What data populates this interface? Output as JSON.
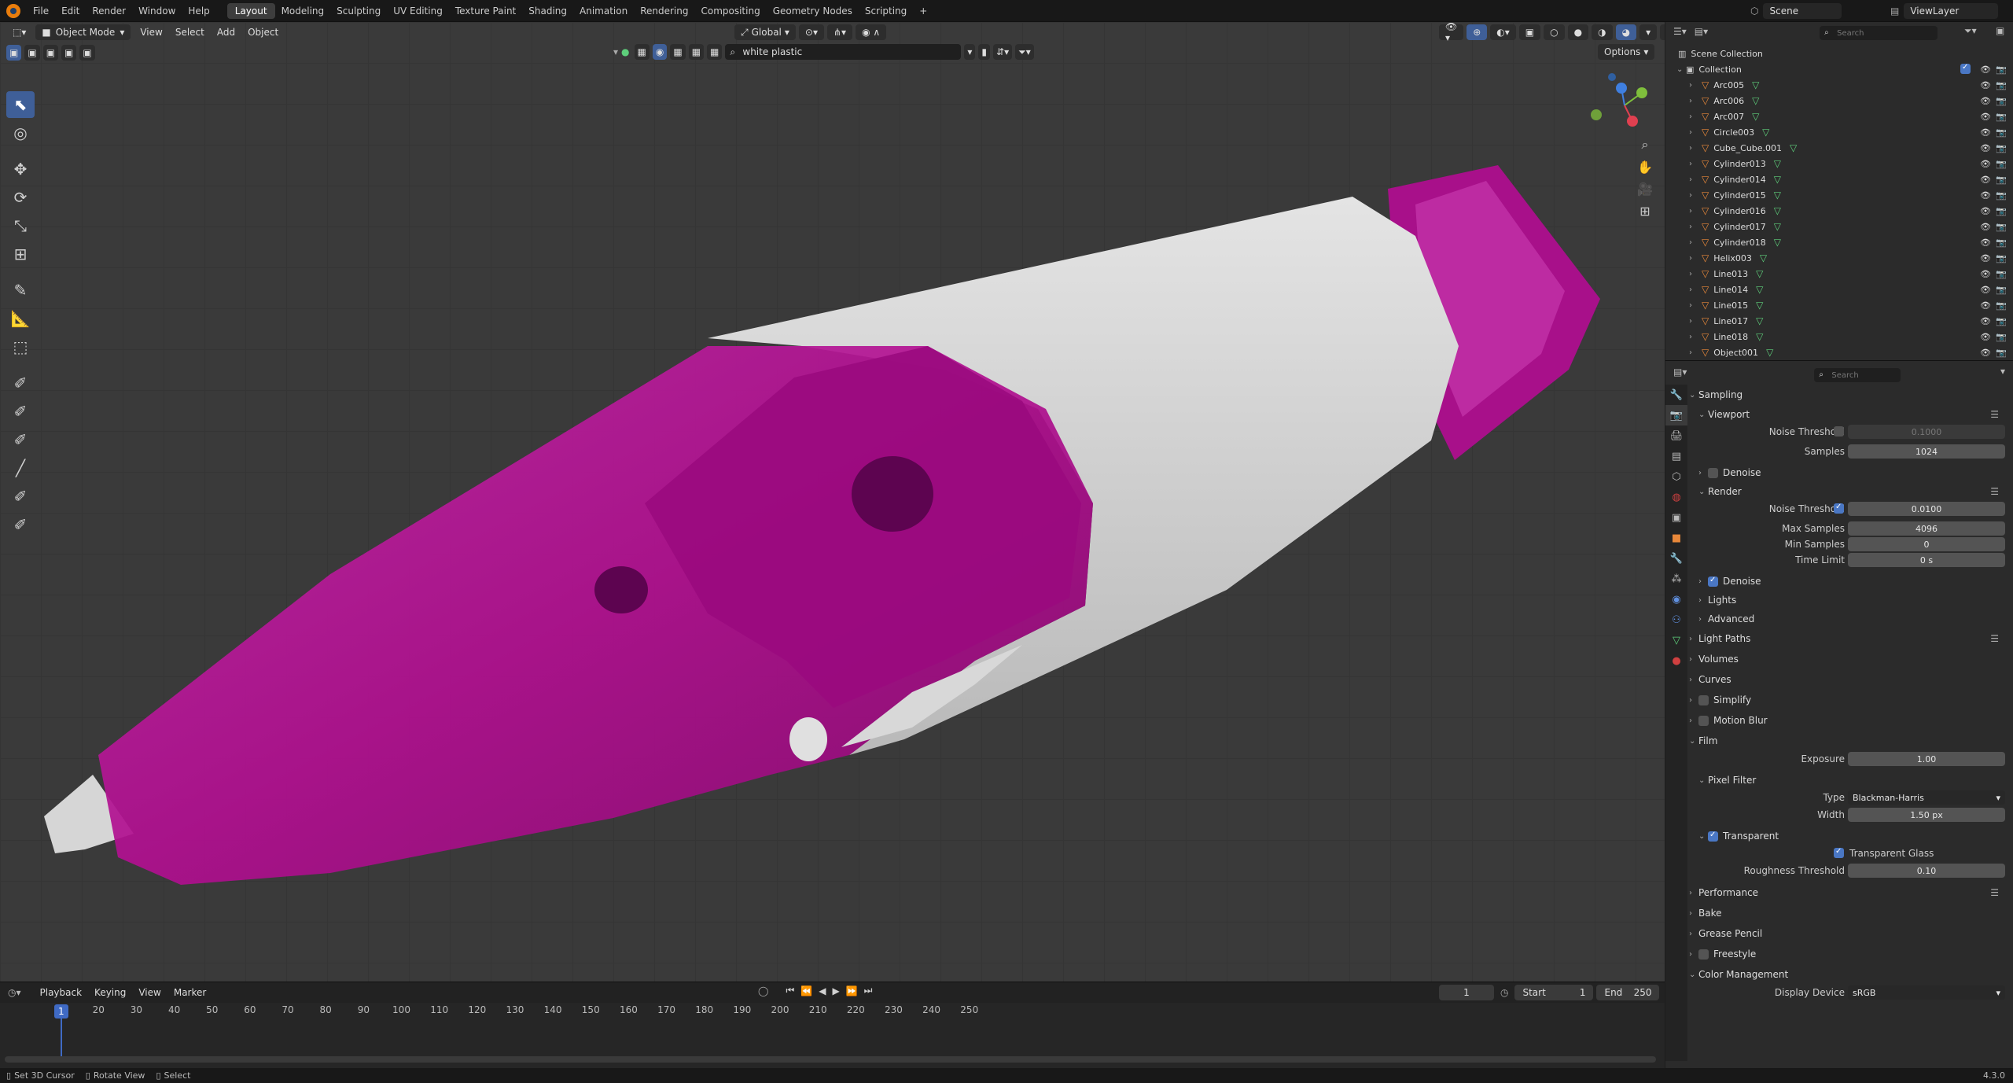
{
  "topbar": {
    "menus": [
      "File",
      "Edit",
      "Render",
      "Window",
      "Help"
    ],
    "workspaces": [
      "Layout",
      "Modeling",
      "Sculpting",
      "UV Editing",
      "Texture Paint",
      "Shading",
      "Animation",
      "Rendering",
      "Compositing",
      "Geometry Nodes",
      "Scripting"
    ],
    "active_workspace": "Layout",
    "add_tab": "+",
    "scene": "Scene",
    "view_layer": "ViewLayer"
  },
  "viewport": {
    "mode": "Object Mode",
    "menus": [
      "View",
      "Select",
      "Add",
      "Object"
    ],
    "transform_orientation": "Global",
    "material_search": "white plastic",
    "options": "Options"
  },
  "outliner": {
    "search_placeholder": "Search",
    "scene_collection": "Scene Collection",
    "collection": "Collection",
    "objects": [
      "Arc005",
      "Arc006",
      "Arc007",
      "Circle003",
      "Cube_Cube.001",
      "Cylinder013",
      "Cylinder014",
      "Cylinder015",
      "Cylinder016",
      "Cylinder017",
      "Cylinder018",
      "Helix003",
      "Line013",
      "Line014",
      "Line015",
      "Line017",
      "Line018",
      "Object001"
    ]
  },
  "properties": {
    "search_placeholder": "Search",
    "sampling": "Sampling",
    "viewport": "Viewport",
    "noise_threshold_label": "Noise Threshold",
    "viewport_noise_threshold": "0.1000",
    "samples_label": "Samples",
    "viewport_samples": "1024",
    "denoise": "Denoise",
    "render": "Render",
    "render_noise_threshold": "0.0100",
    "max_samples_label": "Max Samples",
    "max_samples": "4096",
    "min_samples_label": "Min Samples",
    "min_samples": "0",
    "time_limit_label": "Time Limit",
    "time_limit": "0 s",
    "lights": "Lights",
    "advanced": "Advanced",
    "light_paths": "Light Paths",
    "volumes": "Volumes",
    "curves": "Curves",
    "simplify": "Simplify",
    "motion_blur": "Motion Blur",
    "film": "Film",
    "exposure_label": "Exposure",
    "exposure": "1.00",
    "pixel_filter": "Pixel Filter",
    "type_label": "Type",
    "filter_type": "Blackman-Harris",
    "width_label": "Width",
    "filter_width": "1.50 px",
    "transparent": "Transparent",
    "transparent_glass": "Transparent Glass",
    "roughness_threshold_label": "Roughness Threshold",
    "roughness_threshold": "0.10",
    "performance": "Performance",
    "bake": "Bake",
    "grease_pencil": "Grease Pencil",
    "freestyle": "Freestyle",
    "color_management": "Color Management",
    "display_device_label": "Display Device",
    "display_device": "sRGB"
  },
  "timeline": {
    "menus": [
      "Playback",
      "Keying",
      "View",
      "Marker"
    ],
    "current_frame": "1",
    "start_label": "Start",
    "start": "1",
    "end_label": "End",
    "end": "250",
    "ticks": [
      "10",
      "20",
      "30",
      "40",
      "50",
      "60",
      "70",
      "80",
      "90",
      "100",
      "110",
      "120",
      "130",
      "140",
      "150",
      "160",
      "170",
      "180",
      "190",
      "200",
      "210",
      "220",
      "230",
      "240",
      "250"
    ],
    "frame_indicator": "1"
  },
  "statusbar": {
    "hint1": "Set 3D Cursor",
    "hint2": "Rotate View",
    "hint3": "Select",
    "version": "4.3.0"
  },
  "colors": {
    "accent_blue": "#4a77c4",
    "object_orange": "#e8883a",
    "mesh_green": "#5ecf7b",
    "model_magenta": "#b0108f",
    "model_white": "#cfcfcf"
  }
}
